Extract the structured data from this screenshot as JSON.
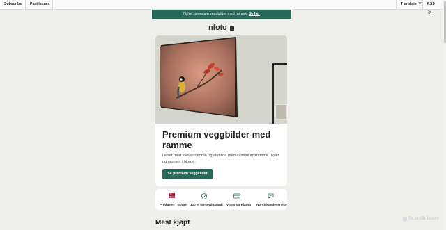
{
  "topbar": {
    "subscribe_label": "Subscribe",
    "past_issues_label": "Past Issues",
    "translate_label": "Translate",
    "rss_label": "RSS"
  },
  "notice": {
    "text": "Nyhet: premium veggbilder med ramme.",
    "link_label": "Se her"
  },
  "logo": {
    "text": "nfoto"
  },
  "hero": {
    "title": "Premium veggbilder med ramme",
    "description": "Lerret med svevenramme og alubilde med aluminiumsramme. Trykt og montert i Norge.",
    "button_label": "Se premium veggbilder"
  },
  "features": [
    {
      "icon": "norwegian-flag-icon",
      "label": "Produsert i Norge"
    },
    {
      "icon": "shield-check-icon",
      "label": "100 % fornøydgaranti"
    },
    {
      "icon": "credit-card-icon",
      "label": "Vipps og Klarna"
    },
    {
      "icon": "chat-icon",
      "label": "Norsk kundeservice"
    }
  ],
  "section": {
    "title": "Mest kjøpt"
  },
  "watermark": {
    "text": "ScanMalware"
  },
  "colors": {
    "brand_green": "#256a58",
    "background": "#efefeb"
  }
}
